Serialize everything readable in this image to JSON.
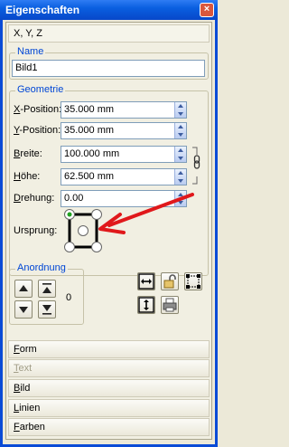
{
  "window": {
    "title": "Eigenschaften",
    "close_glyph": "×"
  },
  "tab_xyz": {
    "label": "X, Y, Z"
  },
  "name_group": {
    "title": "Name",
    "value": "Bild1"
  },
  "geometry": {
    "title": "Geometrie",
    "x_position": {
      "label_u": "X",
      "label_rest": "-Position:",
      "value": "35.000 mm"
    },
    "y_position": {
      "label_u": "Y",
      "label_rest": "-Position:",
      "value": "35.000 mm"
    },
    "width": {
      "label_u": "B",
      "label_rest": "reite:",
      "value": "100.000 mm"
    },
    "height": {
      "label_u": "H",
      "label_rest": "öhe:",
      "value": "62.500 mm"
    },
    "rotation": {
      "label_u": "D",
      "label_rest": "rehung:",
      "value": "0.00"
    },
    "origin": {
      "label": "Ursprung:"
    }
  },
  "arrangement": {
    "title": "Anordnung",
    "level": "0"
  },
  "bottom_tabs": [
    {
      "label_u": "F",
      "label_rest": "orm",
      "enabled": true
    },
    {
      "label_u": "T",
      "label_rest": "ext",
      "enabled": false
    },
    {
      "label_u": "B",
      "label_rest": "ild",
      "enabled": true
    },
    {
      "label_u": "L",
      "label_rest": "inien",
      "enabled": true
    },
    {
      "label_u": "F",
      "label_rest": "arben",
      "enabled": true
    }
  ],
  "colors": {
    "accent": "#0046d5",
    "annotation_arrow": "#e0181b",
    "titlebar": "#0a5fe0"
  }
}
